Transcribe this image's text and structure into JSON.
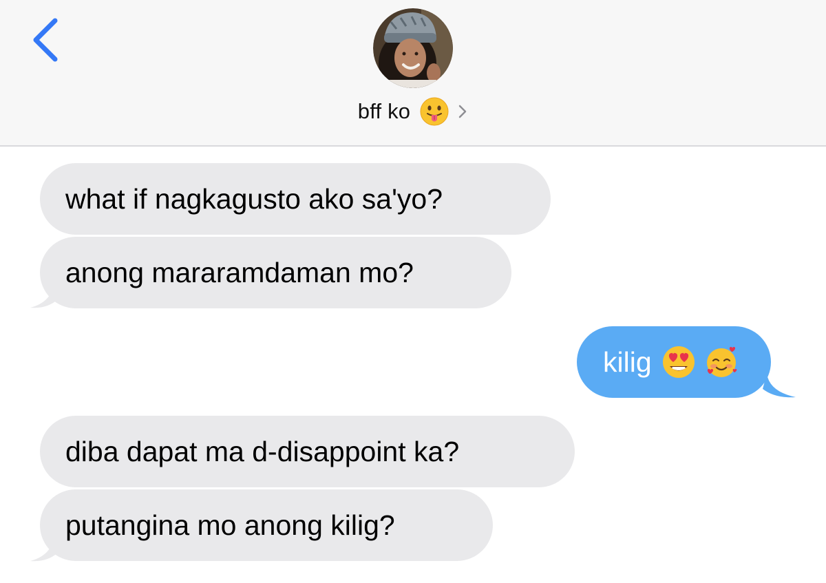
{
  "header": {
    "back_icon": "chevron-left-icon",
    "contact": {
      "name": "bff ko",
      "emoji": "face-with-tongue-emoji",
      "chevron": "chevron-right-icon"
    },
    "avatar": "contact-photo"
  },
  "messages": [
    {
      "direction": "incoming",
      "text": "what if nagkagusto ako sa'yo?"
    },
    {
      "direction": "incoming",
      "text": "anong mararamdaman mo?"
    },
    {
      "direction": "outgoing",
      "text": "kilig",
      "emojis": [
        "heart-eyes-emoji",
        "smiling-face-with-hearts-emoji"
      ]
    },
    {
      "direction": "incoming",
      "text": "diba dapat ma d-disappoint ka?"
    },
    {
      "direction": "incoming",
      "text": "putangina mo anong kilig?"
    }
  ],
  "colors": {
    "header_bg": "#f7f7f7",
    "ios_blue": "#3478f6",
    "incoming_bubble": "#e9e9eb",
    "outgoing_bubble": "#5aabf4"
  }
}
